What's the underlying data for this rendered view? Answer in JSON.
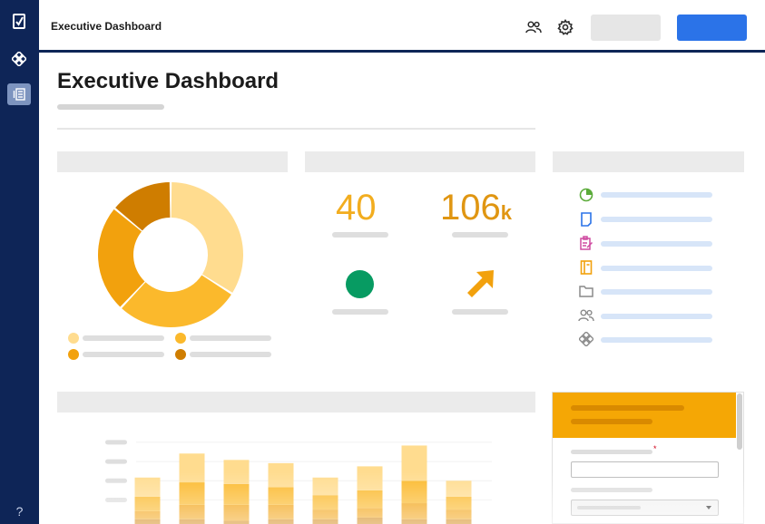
{
  "header": {
    "title": "Executive Dashboard"
  },
  "page": {
    "title": "Executive Dashboard"
  },
  "sidebar": {
    "items": [
      {
        "icon": "checklist-icon"
      },
      {
        "icon": "diamond-cluster-icon"
      },
      {
        "icon": "report-icon",
        "active": true
      }
    ],
    "help_label": "?"
  },
  "metrics": [
    {
      "value": "40",
      "icon": "status-dot-icon",
      "icon_color": "#079b62"
    },
    {
      "value": "106",
      "unit": "k",
      "icon": "trend-up-arrow-icon",
      "icon_color": "#f2a10d"
    }
  ],
  "donut": {
    "slices": [
      {
        "value": 34,
        "color": "#ffdc8f"
      },
      {
        "value": 28,
        "color": "#fbb92c"
      },
      {
        "value": 24,
        "color": "#f2a10d"
      },
      {
        "value": 14,
        "color": "#cf7d00"
      }
    ],
    "legend_colors": [
      "#ffdc8f",
      "#fbb92c",
      "#f2a10d",
      "#cf7d00"
    ]
  },
  "links": [
    {
      "icon": "pie-chart-icon",
      "color": "#5bab3a"
    },
    {
      "icon": "document-icon",
      "color": "#2b73e8"
    },
    {
      "icon": "edit-form-icon",
      "color": "#cf4ba1"
    },
    {
      "icon": "notebook-icon",
      "color": "#f2a10d"
    },
    {
      "icon": "folder-icon",
      "color": "#8a8a8a"
    },
    {
      "icon": "people-icon",
      "color": "#8a8a8a"
    },
    {
      "icon": "diamond-cluster-icon",
      "color": "#8a8a8a"
    }
  ],
  "form": {
    "required_marker": "*"
  },
  "colors": {
    "sidebar": "#0e2557",
    "primary_button": "#2b73e8",
    "accent": "#f5a705"
  },
  "chart_data": {
    "type": "bar",
    "categories": [
      "",
      "",
      "",
      "",
      "",
      "",
      "",
      ""
    ],
    "series": [
      {
        "values": [
          1.2,
          1.8,
          1.5,
          1.5,
          1.1,
          1.5,
          2.2,
          1.0
        ]
      },
      {
        "values": [
          0.9,
          1.4,
          1.3,
          1.1,
          0.9,
          1.1,
          1.4,
          0.8
        ]
      },
      {
        "values": [
          0.5,
          0.9,
          1.0,
          0.9,
          0.6,
          0.6,
          1.0,
          0.6
        ]
      },
      {
        "values": [
          0.3,
          0.3,
          0.2,
          0.3,
          0.3,
          0.4,
          0.3,
          0.3
        ]
      }
    ],
    "stacked": true,
    "colors": [
      "#ffdc8f",
      "#fbb92c",
      "#f2a10d",
      "#cf7d00"
    ],
    "ylim": [
      0,
      6
    ],
    "grid": true
  }
}
